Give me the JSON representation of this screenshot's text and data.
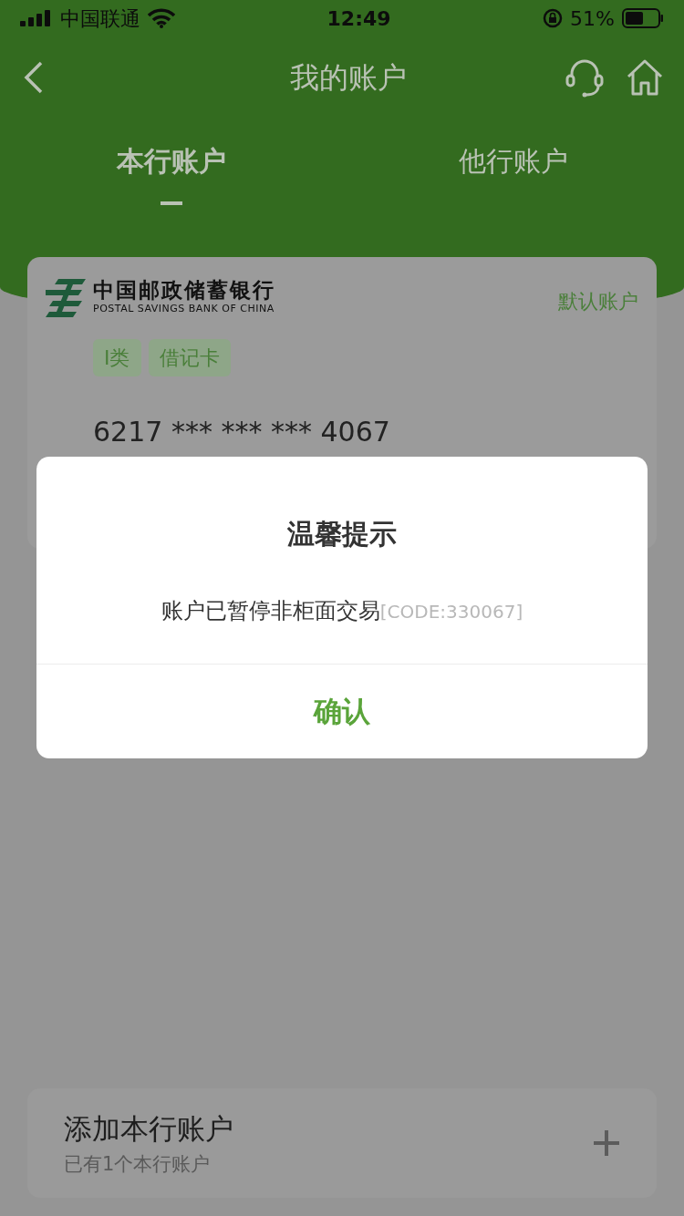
{
  "status_bar": {
    "carrier": "中国联通",
    "time": "12:49",
    "battery": "51%"
  },
  "nav": {
    "title": "我的账户"
  },
  "tabs": [
    {
      "label": "本行账户",
      "selected": true
    },
    {
      "label": "他行账户",
      "selected": false
    }
  ],
  "account_card": {
    "bank_name": "中国邮政储蓄银行",
    "bank_name_en": "POSTAL SAVINGS BANK OF CHINA",
    "default_label": "默认账户",
    "tags": [
      "I类",
      "借记卡"
    ],
    "card_number": "6217 *** *** *** 4067"
  },
  "add_account": {
    "title": "添加本行账户",
    "subtitle": "已有1个本行账户"
  },
  "dialog": {
    "title": "温馨提示",
    "message": "账户已暂停非柜面交易",
    "code": "[CODE:330067]",
    "confirm": "确认"
  }
}
